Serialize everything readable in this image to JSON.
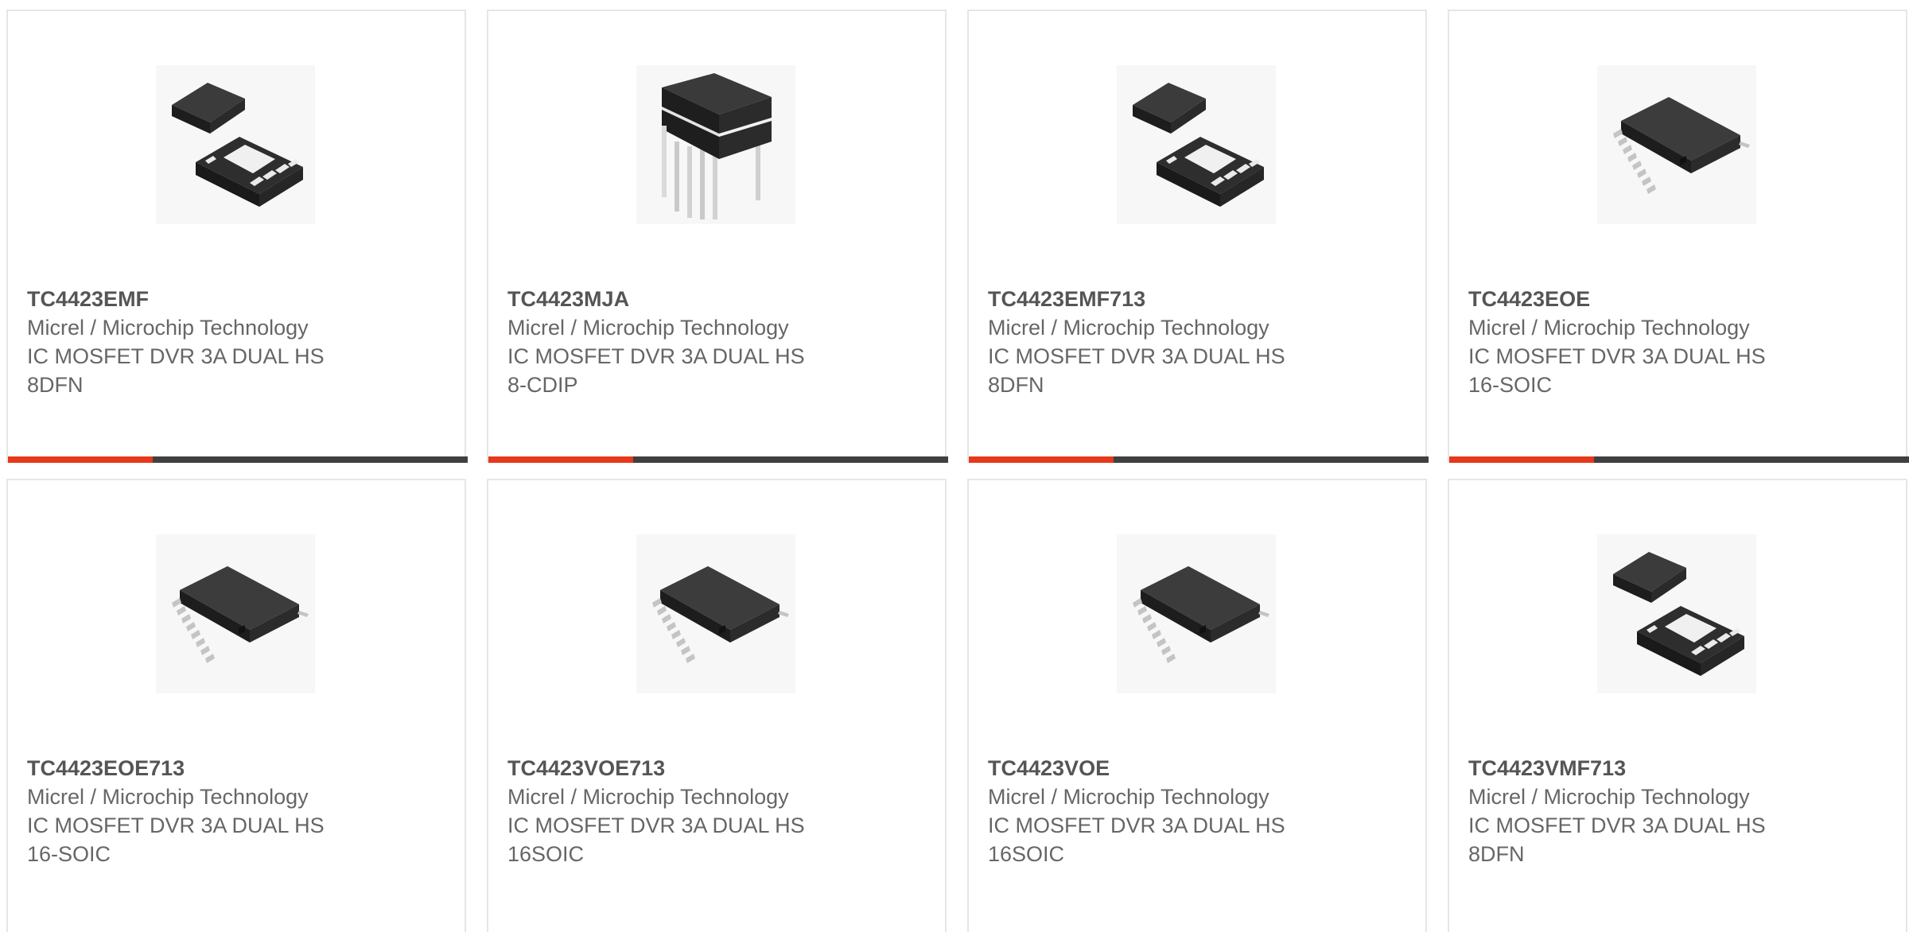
{
  "colors": {
    "accent": "#e6381b",
    "bar": "#404040",
    "text": "#666666",
    "border": "#e6e6e6"
  },
  "cards": [
    {
      "part": "TC4423EMF",
      "maker": "Micrel / Microchip Technology",
      "desc": "IC MOSFET DVR 3A DUAL HS",
      "pkg": "8DFN",
      "icon": "dfn-chip-icon",
      "bar": true
    },
    {
      "part": "TC4423MJA",
      "maker": "Micrel / Microchip Technology",
      "desc": "IC MOSFET DVR 3A DUAL HS",
      "pkg": "8-CDIP",
      "icon": "dip-chip-icon",
      "bar": true
    },
    {
      "part": "TC4423EMF713",
      "maker": "Micrel / Microchip Technology",
      "desc": "IC MOSFET DVR 3A DUAL HS",
      "pkg": "8DFN",
      "icon": "dfn-chip-icon",
      "bar": true
    },
    {
      "part": "TC4423EOE",
      "maker": "Micrel / Microchip Technology",
      "desc": "IC MOSFET DVR 3A DUAL HS",
      "pkg": "16-SOIC",
      "icon": "soic-chip-icon",
      "bar": true
    },
    {
      "part": "TC4423EOE713",
      "maker": "Micrel / Microchip Technology",
      "desc": "IC MOSFET DVR 3A DUAL HS",
      "pkg": "16-SOIC",
      "icon": "soic-chip-icon",
      "bar": false
    },
    {
      "part": "TC4423VOE713",
      "maker": "Micrel / Microchip Technology",
      "desc": "IC MOSFET DVR 3A DUAL HS",
      "pkg": "16SOIC",
      "icon": "soic-chip-icon",
      "bar": false
    },
    {
      "part": "TC4423VOE",
      "maker": "Micrel / Microchip Technology",
      "desc": "IC MOSFET DVR 3A DUAL HS",
      "pkg": "16SOIC",
      "icon": "soic-chip-icon",
      "bar": false
    },
    {
      "part": "TC4423VMF713",
      "maker": "Micrel / Microchip Technology",
      "desc": "IC MOSFET DVR 3A DUAL HS",
      "pkg": "8DFN",
      "icon": "dfn-chip-icon",
      "bar": false
    }
  ]
}
